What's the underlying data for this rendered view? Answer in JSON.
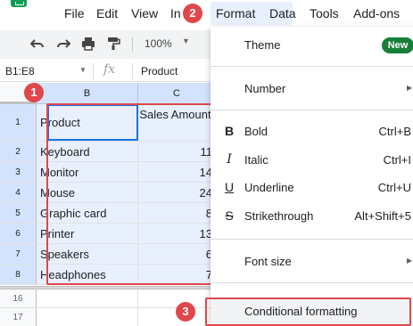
{
  "menubar": {
    "items": [
      "File",
      "Edit",
      "View",
      "In",
      "Format",
      "Data",
      "Tools",
      "Add-ons"
    ]
  },
  "toolbar": {
    "zoom": "100%"
  },
  "formula_bar": {
    "name_box": "B1:E8",
    "fx": "fx",
    "value": "Product"
  },
  "grid": {
    "columns": [
      "B",
      "C"
    ],
    "rows": [
      {
        "num": "1",
        "b": "Product",
        "c": "Sales Amount"
      },
      {
        "num": "2",
        "b": "Keyboard",
        "c": "11"
      },
      {
        "num": "3",
        "b": "Monitor",
        "c": "14"
      },
      {
        "num": "4",
        "b": "Mouse",
        "c": "24"
      },
      {
        "num": "5",
        "b": "Graphic card",
        "c": "8"
      },
      {
        "num": "6",
        "b": "Printer",
        "c": "13"
      },
      {
        "num": "7",
        "b": "Speakers",
        "c": "6"
      },
      {
        "num": "8",
        "b": "Headphones",
        "c": "7"
      }
    ],
    "after_rows": [
      "16",
      "17"
    ]
  },
  "format_menu": {
    "theme": "Theme",
    "theme_badge": "New",
    "number": "Number",
    "bold": "Bold",
    "bold_shortcut": "Ctrl+B",
    "italic": "Italic",
    "italic_shortcut": "Ctrl+I",
    "underline": "Underline",
    "underline_shortcut": "Ctrl+U",
    "strikethrough": "Strikethrough",
    "strikethrough_shortcut": "Alt+Shift+5",
    "font_size": "Font size",
    "conditional_formatting": "Conditional formatting"
  },
  "annotations": {
    "step1": "1",
    "step2": "2",
    "step3": "3"
  },
  "colors": {
    "annotation_red": "#e0474c",
    "selection_blue": "#1a73e8",
    "new_badge_green": "#188038"
  }
}
